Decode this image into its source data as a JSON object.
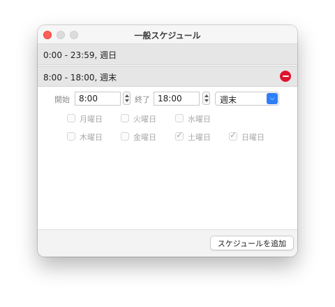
{
  "window": {
    "title": "一般スケジュール"
  },
  "schedules": [
    {
      "label": "0:00 - 23:59, 週日"
    },
    {
      "label": "8:00 - 18:00, 週末"
    }
  ],
  "editor": {
    "start_label": "開始",
    "start_time": "8:00",
    "end_label": "終了",
    "end_time": "18:00",
    "preset_select": "週末",
    "days": [
      {
        "label": "月曜日",
        "checked": false
      },
      {
        "label": "火曜日",
        "checked": false
      },
      {
        "label": "水曜日",
        "checked": false
      },
      {
        "label": "木曜日",
        "checked": false
      },
      {
        "label": "金曜日",
        "checked": false
      },
      {
        "label": "土曜日",
        "checked": true
      },
      {
        "label": "日曜日",
        "checked": true
      }
    ]
  },
  "footer": {
    "add_button": "スケジュールを追加"
  },
  "icons": {
    "remove": "minus-circle-icon",
    "checkmark": "checkmark-icon",
    "select_arrow": "chevron-down-icon"
  },
  "colors": {
    "remove_red": "#e0112b",
    "accent_blue": "#2d7ef7",
    "close_red": "#ff5f57"
  }
}
